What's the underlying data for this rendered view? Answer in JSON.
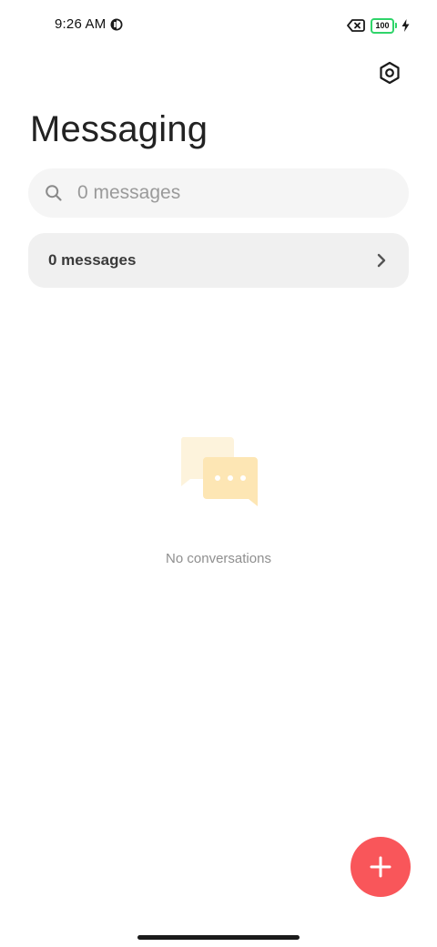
{
  "status_bar": {
    "time": "9:26 AM",
    "battery_level": "100"
  },
  "header": {
    "title": "Messaging"
  },
  "search": {
    "placeholder": "0 messages"
  },
  "messages_row": {
    "label": "0 messages"
  },
  "empty_state": {
    "text": "No conversations"
  },
  "icons": {
    "settings": "settings-hexagon-icon",
    "search": "search-icon",
    "chevron": "chevron-right-icon",
    "fab": "plus-icon"
  },
  "colors": {
    "accent": "#f9565a",
    "battery": "#2fd46a",
    "illustration_back": "#fdf3dc",
    "illustration_front": "#fde6b4"
  }
}
